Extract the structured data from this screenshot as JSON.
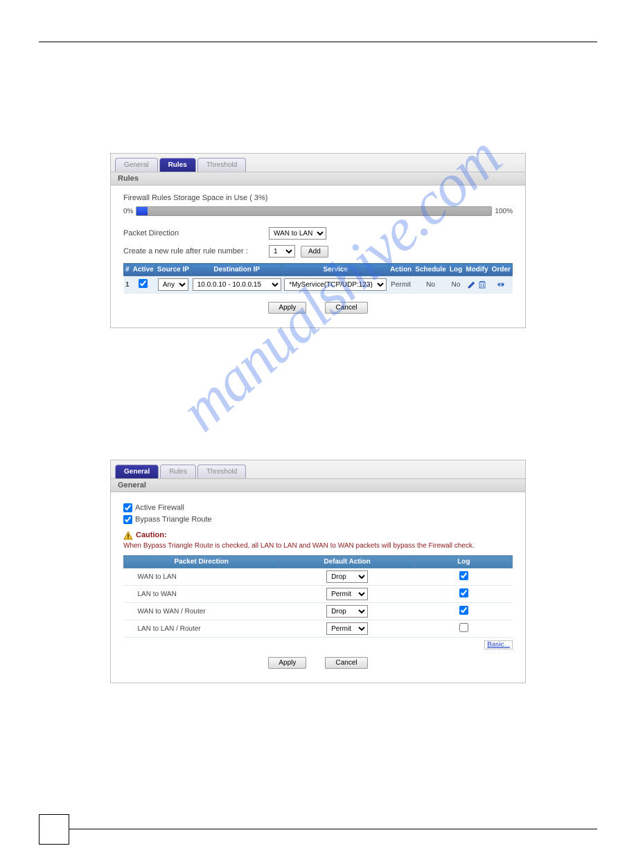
{
  "watermark": "manualshive.com",
  "panel1": {
    "tabs": {
      "general": "General",
      "rules": "Rules",
      "threshold": "Threshold"
    },
    "sectionTitle": "Rules",
    "storageLabel": "Firewall Rules Storage Space in Use  ( 3%)",
    "pctLeft": "0%",
    "pctRight": "100%",
    "packetDirLabel": "Packet Direction",
    "packetDirValue": "WAN to LAN",
    "createRuleLabel": "Create a new rule after rule number :",
    "ruleNumValue": "1",
    "addLabel": "Add",
    "cols": {
      "num": "#",
      "active": "Active",
      "srcip": "Source IP",
      "dstip": "Destination IP",
      "service": "Service",
      "action": "Action",
      "schedule": "Schedule",
      "log": "Log",
      "modify": "Modify",
      "order": "Order"
    },
    "row": {
      "num": "1",
      "srcip": "Any",
      "dstip": "10.0.0.10 - 10.0.0.15",
      "service": "*MyService(TCP/UDP:123)",
      "action": "Permit",
      "schedule": "No",
      "log": "No"
    },
    "applyLabel": "Apply",
    "cancelLabel": "Cancel"
  },
  "panel2": {
    "tabs": {
      "general": "General",
      "rules": "Rules",
      "threshold": "Threshold"
    },
    "sectionTitle": "General",
    "activeFirewall": "Active Firewall",
    "bypassTriangle": "Bypass Triangle Route",
    "cautionTitle": "Caution:",
    "cautionText": "When Bypass Triangle Route is checked, all LAN to LAN and WAN to WAN packets will bypass the Firewall check.",
    "cols": {
      "dir": "Packet Direction",
      "action": "Default Action",
      "log": "Log"
    },
    "rows": [
      {
        "dir": "WAN to LAN",
        "action": "Drop",
        "log": true
      },
      {
        "dir": "LAN to WAN",
        "action": "Permit",
        "log": true
      },
      {
        "dir": "WAN to WAN / Router",
        "action": "Drop",
        "log": true
      },
      {
        "dir": "LAN to LAN / Router",
        "action": "Permit",
        "log": false
      }
    ],
    "basicLink": "Basic...",
    "applyLabel": "Apply",
    "cancelLabel": "Cancel"
  }
}
